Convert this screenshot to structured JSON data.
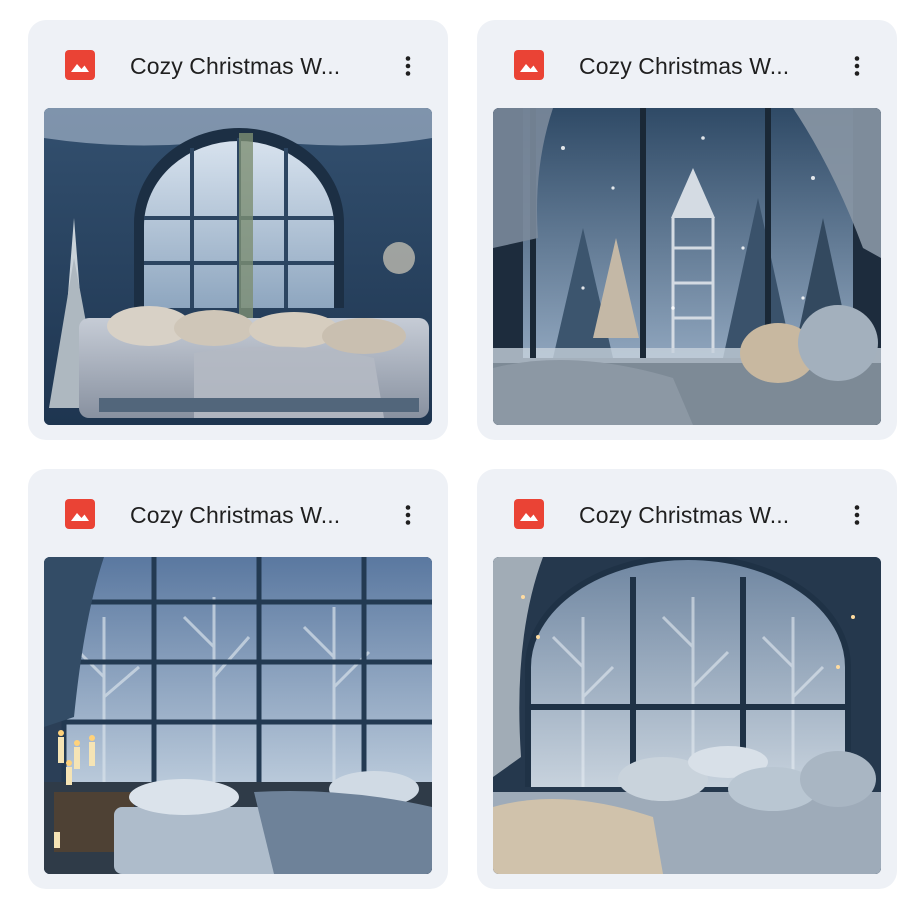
{
  "files": [
    {
      "name": "Cozy Christmas W...",
      "icon": "image-file-icon",
      "icon_color": "#ea4335",
      "thumbnail": "arched window bedroom with snowy forest view and christmas tree"
    },
    {
      "name": "Cozy Christmas W...",
      "icon": "image-file-icon",
      "icon_color": "#ea4335",
      "thumbnail": "large window with snowy forest, drapes and pillows"
    },
    {
      "name": "Cozy Christmas W...",
      "icon": "image-file-icon",
      "icon_color": "#ea4335",
      "thumbnail": "grid window over bed with candles and snowy trees"
    },
    {
      "name": "Cozy Christmas W...",
      "icon": "image-file-icon",
      "icon_color": "#ea4335",
      "thumbnail": "arched window daybed with pillows and snowy forest"
    }
  ],
  "more_icon": "more-vert-icon",
  "colors": {
    "card_background": "#eef1f6",
    "text": "#1f1f1f"
  }
}
